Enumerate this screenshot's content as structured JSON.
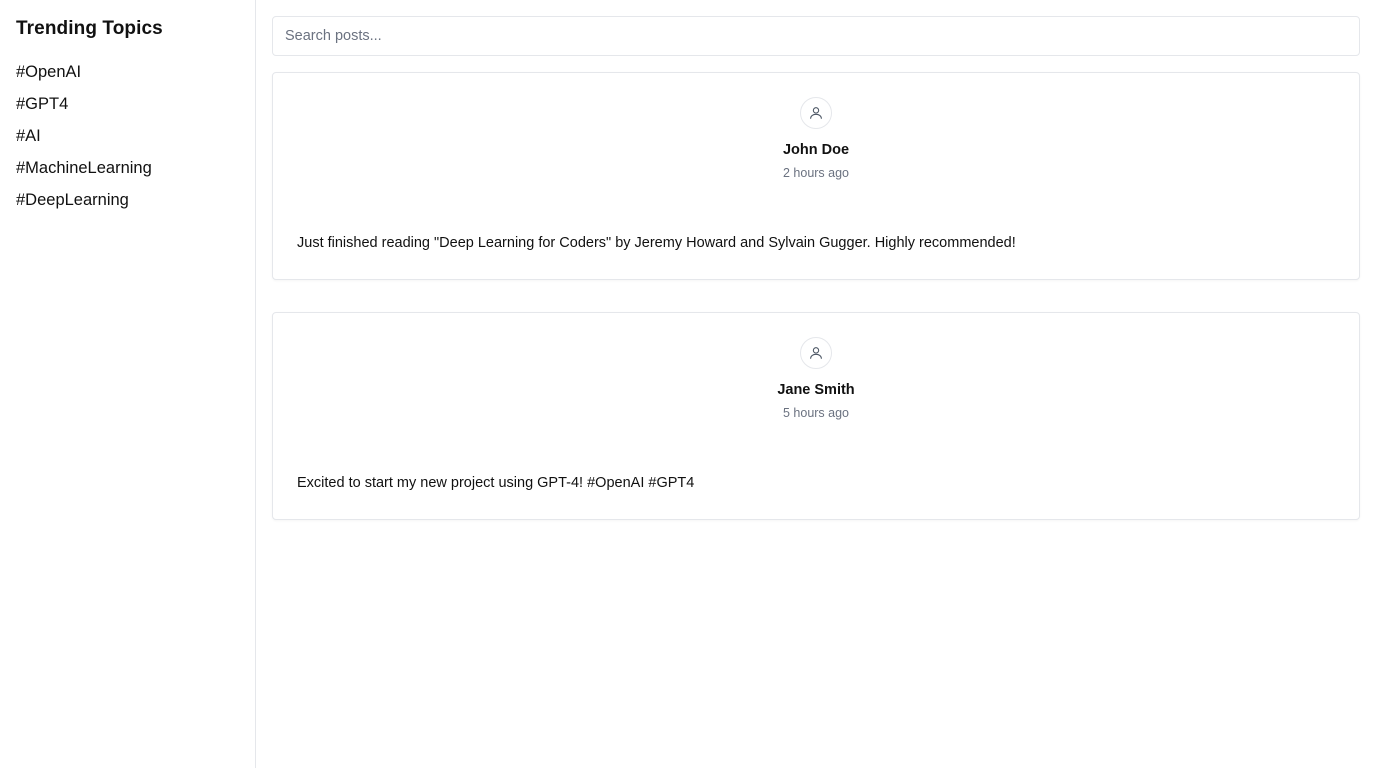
{
  "sidebar": {
    "title": "Trending Topics",
    "topics": [
      "#OpenAI",
      "#GPT4",
      "#AI",
      "#MachineLearning",
      "#DeepLearning"
    ]
  },
  "search": {
    "placeholder": "Search posts...",
    "value": ""
  },
  "posts": [
    {
      "author": "John Doe",
      "time": "2 hours ago",
      "content": "Just finished reading \"Deep Learning for Coders\" by Jeremy Howard and Sylvain Gugger. Highly recommended!",
      "avatar_icon": "user-icon"
    },
    {
      "author": "Jane Smith",
      "time": "5 hours ago",
      "content": "Excited to start my new project using GPT-4! #OpenAI #GPT4",
      "avatar_icon": "user-icon"
    }
  ],
  "colors": {
    "border": "#e5e7eb",
    "muted_text": "#6b7280",
    "text": "#111111",
    "background": "#ffffff"
  }
}
